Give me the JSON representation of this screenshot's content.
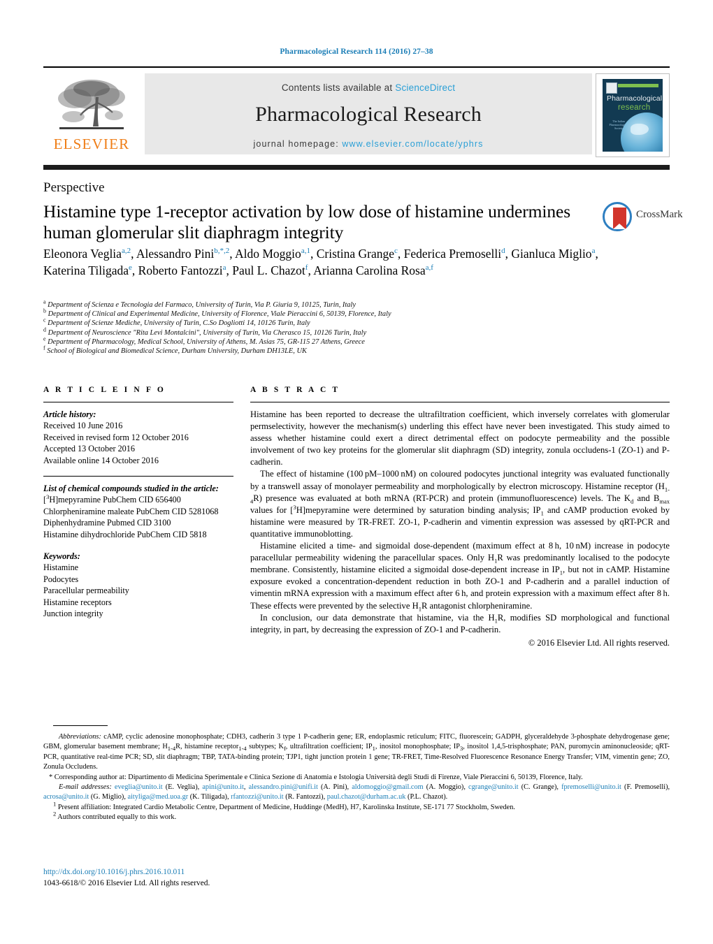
{
  "running_head": "Pharmacological Research 114 (2016) 27–38",
  "masthead": {
    "contents_prefix": "Contents lists available at ",
    "sciencedirect": "ScienceDirect",
    "journal_title": "Pharmacological Research",
    "homepage_prefix": "journal homepage: ",
    "homepage_url": "www.elsevier.com/locate/yphrs",
    "publisher": "ELSEVIER",
    "cover": {
      "line1": "Pharmacological",
      "line2": "research",
      "society": "The Italian Pharmacological Society"
    },
    "accent_blue": "#2a9fd6",
    "elsevier_orange": "#ef7d16"
  },
  "article": {
    "section_type": "Perspective",
    "title": "Histamine type 1-receptor activation by low dose of histamine undermines human glomerular slit diaphragm integrity",
    "crossmark_label": "CrossMark",
    "authors": [
      {
        "name": "Eleonora Veglia",
        "marks": "a,2",
        "sep": ", "
      },
      {
        "name": "Alessandro Pini",
        "marks": "b,*,2",
        "sep": ", "
      },
      {
        "name": "Aldo Moggio",
        "marks": "a,1",
        "sep": ", "
      },
      {
        "name": "Cristina Grange",
        "marks": "c",
        "sep": ", "
      },
      {
        "name": "Federica Premoselli",
        "marks": "d",
        "sep": ", "
      },
      {
        "name": "Gianluca Miglio",
        "marks": "a",
        "sep": ", "
      },
      {
        "name": "Katerina Tiligada",
        "marks": "e",
        "sep": ", "
      },
      {
        "name": "Roberto Fantozzi",
        "marks": "a",
        "sep": ", "
      },
      {
        "name": "Paul L. Chazot",
        "marks": "f",
        "sep": ", "
      },
      {
        "name": "Arianna Carolina Rosa",
        "marks": "a,f",
        "sep": ""
      }
    ],
    "affiliations": [
      {
        "marker": "a",
        "text": "Department of Scienza e Tecnologia del Farmaco, University of Turin, Via P. Giuria 9, 10125, Turin, Italy"
      },
      {
        "marker": "b",
        "text": "Department of Clinical and Experimental Medicine, University of Florence, Viale Pieraccini 6, 50139, Florence, Italy"
      },
      {
        "marker": "c",
        "text": "Department of Scienze Mediche, University of Turin, C.So Dogliotti 14, 10126 Turin, Italy"
      },
      {
        "marker": "d",
        "text": "Department of Neuroscience \"Rita Levi Montalcini\", University of Turin, Via Cherasco 15, 10126 Turin, Italy"
      },
      {
        "marker": "e",
        "text": "Department of Pharmacology, Medical School, University of Athens, M. Asias 75, GR-115 27 Athens, Greece"
      },
      {
        "marker": "f",
        "text": "School of Biological and Biomedical Science, Durham University, Durham DH13LE, UK"
      }
    ]
  },
  "article_info": {
    "heading": "A R T I C L E   I N F O",
    "history_label": "Article history:",
    "history": [
      "Received 10 June 2016",
      "Received in revised form 12 October 2016",
      "Accepted 13 October 2016",
      "Available online 14 October 2016"
    ],
    "compounds_label": "List of chemical compounds studied in the article:",
    "compounds": [
      "[3H]mepyramine PubChem CID 656400",
      "Chlorpheniramine maleate PubChem CID 5281068",
      "Diphenhydramine Pubmed CID 3100",
      "Histamine dihydrochloride PubChem CID 5818"
    ],
    "keywords_label": "Keywords:",
    "keywords": [
      "Histamine",
      "Podocytes",
      "Paracellular permeability",
      "Histamine receptors",
      "Junction integrity"
    ]
  },
  "abstract": {
    "heading": "A B S T R A C T",
    "paragraphs": [
      "Histamine has been reported to decrease the ultrafiltration coefficient, which inversely correlates with glomerular permselectivity, however the mechanism(s) underling this effect have never been investigated. This study aimed to assess whether histamine could exert a direct detrimental effect on podocyte permeability and the possible involvement of two key proteins for the glomerular slit diaphragm (SD) integrity, zonula occludens-1 (ZO-1) and P-cadherin.",
      "The effect of histamine (100 pM–1000 nM) on coloured podocytes junctional integrity was evaluated functionally by a transwell assay of monolayer permeability and morphologically by electron microscopy. Histamine receptor (H1-4R) presence was evaluated at both mRNA (RT-PCR) and protein (immunofluorescence) levels. The Kd and Bmax values for [3H]mepyramine were determined by saturation binding analysis; IP1 and cAMP production evoked by histamine were measured by TR-FRET. ZO-1, P-cadherin and vimentin expression was assessed by qRT-PCR and quantitative immunoblotting.",
      "Histamine elicited a time- and sigmoidal dose-dependent (maximum effect at 8 h, 10 nM) increase in podocyte paracellular permeability widening the paracellular spaces. Only H1R was predominantly localised to the podocyte membrane. Consistently, histamine elicited a sigmoidal dose-dependent increase in IP1, but not in cAMP. Histamine exposure evoked a concentration-dependent reduction in both ZO-1 and P-cadherin and a parallel induction of vimentin mRNA expression with a maximum effect after 6 h, and protein expression with a maximum effect after 8 h. These effects were prevented by the selective H1R antagonist chlorpheniramine.",
      "In conclusion, our data demonstrate that histamine, via the H1R, modifies SD morphological and functional integrity, in part, by decreasing the expression of ZO-1 and P-cadherin."
    ],
    "copyright": "© 2016 Elsevier Ltd. All rights reserved."
  },
  "footnotes": {
    "abbreviations_label": "Abbreviations:",
    "abbreviations_text": "cAMP, cyclic adenosine monophosphate; CDH3, cadherin 3 type 1 P-cadherin gene; ER, endoplasmic reticulum; FITC, fluorescein; GADPH, glyceraldehyde 3-phosphate dehydrogenase gene; GBM, glomerular basement membrane; H1-4R, histamine receptor1-4 subtypes; Kf, ultrafiltration coefficient; IP1, inositol monophosphate; IP3, inositol 1,4,5-trisphosphate; PAN, puromycin aminonucleoside; qRT-PCR, quantitative real-time PCR; SD, slit diaphragm; TBP, TATA-binding protein; TJP1, tight junction protein 1 gene; TR-FRET, Time-Resolved Fluorescence Resonance Energy Transfer; VIM, vimentin gene; ZO, Zonula Occludens.",
    "corresponding_marker": "*",
    "corresponding_text": "Corresponding author at: Dipartimento di Medicina Sperimentale e Clinica Sezione di Anatomia e Istologia Università degli Studi di Firenze, Viale Pieraccini 6, 50139, Florence, Italy.",
    "email_label": "E-mail addresses:",
    "emails": [
      {
        "address": "eveglia@unito.it",
        "owner": "(E. Veglia)"
      },
      {
        "address": "apini@unito.it",
        "owner": ""
      },
      {
        "address": "alessandro.pini@unifi.it",
        "owner": "(A. Pini)"
      },
      {
        "address": "aldomoggio@gmail.com",
        "owner": "(A. Moggio)"
      },
      {
        "address": "cgrange@unito.it",
        "owner": "(C. Grange)"
      },
      {
        "address": "fpremoselli@unito.it",
        "owner": "(F. Premoselli)"
      },
      {
        "address": "acrosa@unito.it",
        "owner": "(G. Miglio)"
      },
      {
        "address": "aityliga@med.uoa.gr",
        "owner": "(K. Tiligada)"
      },
      {
        "address": "rfantozzi@unito.it",
        "owner": "(R. Fantozzi)"
      },
      {
        "address": "paul.chazot@durham.ac.uk",
        "owner": "(P.L. Chazot)"
      }
    ],
    "note1_marker": "1",
    "note1_text": "Present affiliation: Integrated Cardio Metabolic Centre, Department of Medicine, Huddinge (MedH), H7, Karolinska Institute, SE-171 77 Stockholm, Sweden.",
    "note2_marker": "2",
    "note2_text": "Authors contributed equally to this work.",
    "doi": "http://dx.doi.org/10.1016/j.phrs.2016.10.011",
    "issn": "1043-6618/© 2016 Elsevier Ltd. All rights reserved."
  }
}
